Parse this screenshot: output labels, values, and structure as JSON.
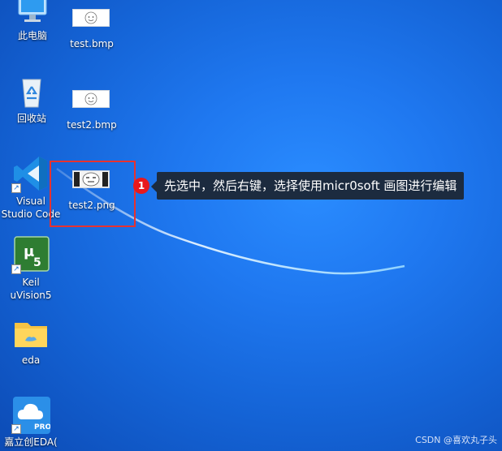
{
  "desktop": {
    "icons": [
      {
        "id": "this-pc",
        "label": "此电脑"
      },
      {
        "id": "test-bmp",
        "label": "test.bmp"
      },
      {
        "id": "recycle-bin",
        "label": "回收站"
      },
      {
        "id": "test2-bmp",
        "label": "test2.bmp"
      },
      {
        "id": "vscode",
        "label": "Visual\nStudio Code"
      },
      {
        "id": "test2-png",
        "label": "test2.png"
      },
      {
        "id": "keil",
        "label": "Keil\nuVision5"
      },
      {
        "id": "eda-folder",
        "label": "eda"
      },
      {
        "id": "jlc-eda",
        "label": "嘉立创EDA("
      }
    ]
  },
  "annotation": {
    "step_number": "1",
    "text": "先选中，然后右键，选择使用micr0soft 画图进行编辑",
    "highlight_color": "#e8322f"
  },
  "watermark": "CSDN @喜欢丸子头"
}
